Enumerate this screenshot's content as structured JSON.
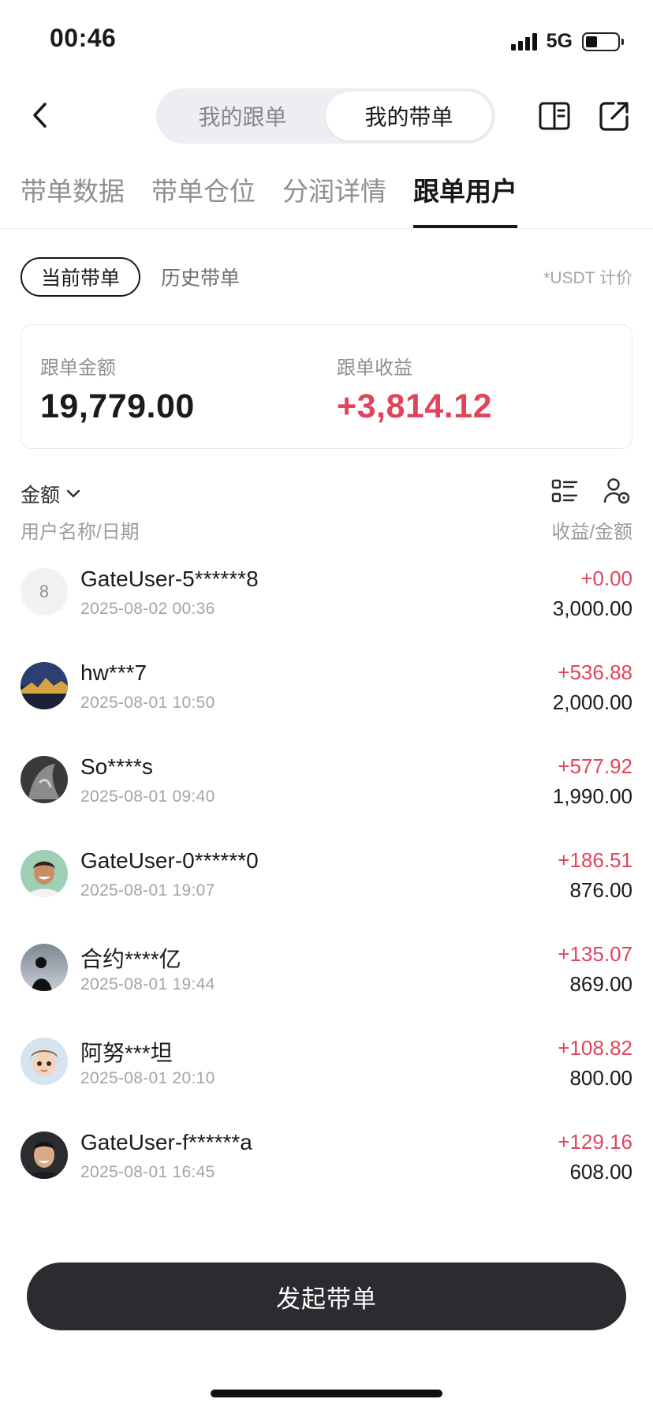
{
  "status_bar": {
    "time": "00:46",
    "network": "5G"
  },
  "header": {
    "segments": [
      "我的跟单",
      "我的带单"
    ],
    "active_segment": 1,
    "icons": [
      "back-icon",
      "book-icon",
      "share-icon"
    ]
  },
  "tabs": [
    {
      "label": "带单数据",
      "active": false
    },
    {
      "label": "带单仓位",
      "active": false
    },
    {
      "label": "分润详情",
      "active": false
    },
    {
      "label": "跟单用户",
      "active": true
    }
  ],
  "filter": {
    "current": "当前带单",
    "history": "历史带单",
    "unit_note": "*USDT 计价"
  },
  "summary": {
    "amount_label": "跟单金额",
    "amount_value": "19,779.00",
    "profit_label": "跟单收益",
    "profit_value": "+3,814.12"
  },
  "sort": {
    "label": "金额",
    "icons": [
      "list-icon",
      "user-settings-icon"
    ]
  },
  "columns": {
    "left": "用户名称/日期",
    "right": "收益/金额"
  },
  "users": [
    {
      "name": "GateUser-5******8",
      "date": "2025-08-02 00:36",
      "profit": "+0.00",
      "amount": "3,000.00",
      "avatar_letter": "8"
    },
    {
      "name": "hw***7",
      "date": "2025-08-01 10:50",
      "profit": "+536.88",
      "amount": "2,000.00"
    },
    {
      "name": "So****s",
      "date": "2025-08-01 09:40",
      "profit": "+577.92",
      "amount": "1,990.00"
    },
    {
      "name": "GateUser-0******0",
      "date": "2025-08-01 19:07",
      "profit": "+186.51",
      "amount": "876.00"
    },
    {
      "name": "合约****亿",
      "date": "2025-08-01 19:44",
      "profit": "+135.07",
      "amount": "869.00"
    },
    {
      "name": "阿努***坦",
      "date": "2025-08-01 20:10",
      "profit": "+108.82",
      "amount": "800.00"
    },
    {
      "name": "GateUser-f******a",
      "date": "2025-08-01 16:45",
      "profit": "+129.16",
      "amount": "608.00"
    }
  ],
  "cta": {
    "label": "发起带单"
  },
  "colors": {
    "accent_red": "#e0455d",
    "dark": "#2b2c2f",
    "muted": "#8d8f94"
  }
}
